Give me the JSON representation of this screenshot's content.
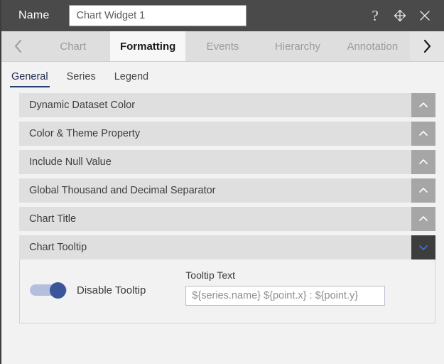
{
  "titlebar": {
    "name_label": "Name",
    "name_value": "Chart Widget 1",
    "name_placeholder": "Chart Widget 1",
    "help_icon": "question-mark-icon",
    "move_icon": "move-arrows-icon",
    "close_icon": "close-icon"
  },
  "tabstrip": {
    "prev_icon": "chevron-left-icon",
    "next_icon": "chevron-right-icon",
    "tabs": [
      {
        "label": "Chart",
        "active": false
      },
      {
        "label": "Formatting",
        "active": true
      },
      {
        "label": "Events",
        "active": false
      },
      {
        "label": "Hierarchy",
        "active": false
      },
      {
        "label": "Annotation",
        "active": false
      }
    ]
  },
  "subtabs": [
    {
      "label": "General",
      "active": true
    },
    {
      "label": "Series",
      "active": false
    },
    {
      "label": "Legend",
      "active": false
    }
  ],
  "accordion": [
    {
      "title": "Dynamic Dataset Color",
      "expanded": false
    },
    {
      "title": "Color & Theme Property",
      "expanded": false
    },
    {
      "title": "Include Null Value",
      "expanded": false
    },
    {
      "title": "Global Thousand and Decimal Separator",
      "expanded": false
    },
    {
      "title": "Chart Title",
      "expanded": false
    },
    {
      "title": "Chart Tooltip",
      "expanded": true
    }
  ],
  "tooltip_panel": {
    "disable_toggle_label": "Disable Tooltip",
    "disable_toggle_state": "on",
    "tooltip_text_label": "Tooltip Text",
    "tooltip_text_value": "${series.name} ${point.x} : ${point.y}"
  },
  "colors": {
    "titlebar_bg": "#4a4a4a",
    "tab_inactive_bg": "#dedede",
    "tab_active_bg": "#f7f7f7",
    "accent_blue": "#2b3f77",
    "toggle_thumb": "#3a559a",
    "toggle_track": "#b4bedd",
    "accordion_header_bg": "#dfdfdf",
    "accordion_toggle_bg": "#a6a6a6",
    "accordion_toggle_active_bg": "#3d3d3d",
    "page_bg": "#f2f2f2"
  }
}
